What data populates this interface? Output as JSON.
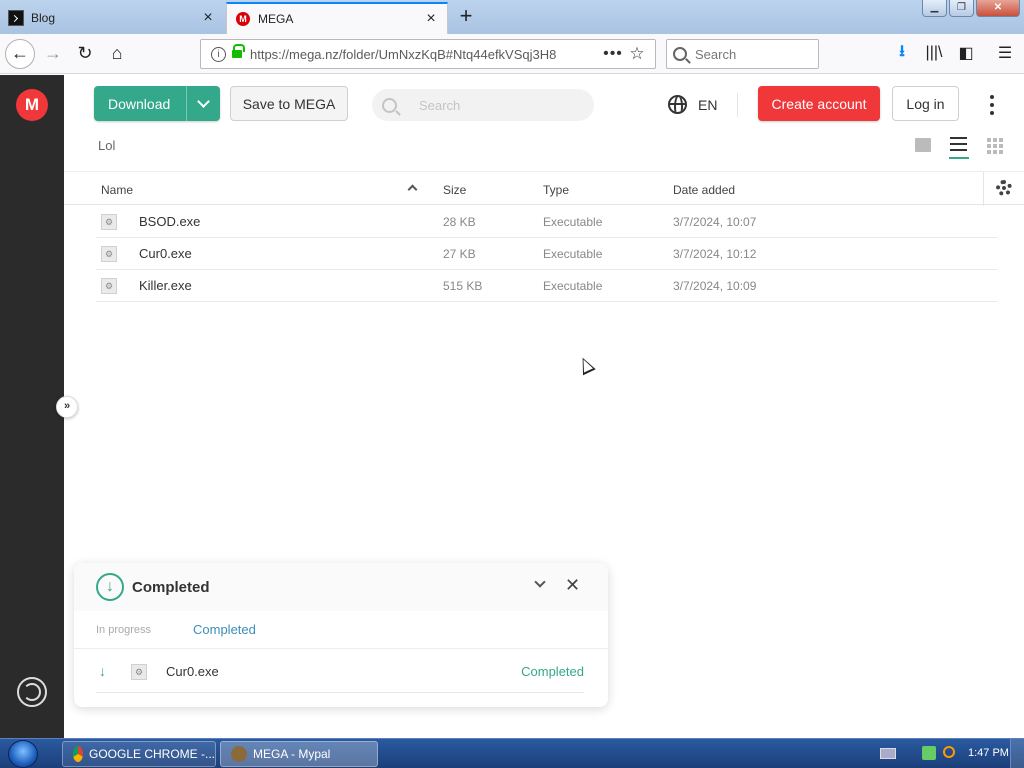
{
  "browser": {
    "tabs": [
      {
        "title": "Blog",
        "active": false
      },
      {
        "title": "MEGA",
        "active": true
      }
    ],
    "url": "https://mega.nz/folder/UmNxzKqB#Ntq44efkVSqj3H8",
    "search_placeholder": "Search"
  },
  "toolbar": {
    "download_label": "Download",
    "save_label": "Save to MEGA",
    "search_placeholder": "Search",
    "language": "EN",
    "create_account_label": "Create account",
    "login_label": "Log in"
  },
  "breadcrumb": "Lol",
  "columns": {
    "name": "Name",
    "size": "Size",
    "type": "Type",
    "date": "Date added"
  },
  "files": [
    {
      "name": "BSOD.exe",
      "size": "28 KB",
      "type": "Executable",
      "date": "3/7/2024, 10:07"
    },
    {
      "name": "Cur0.exe",
      "size": "27 KB",
      "type": "Executable",
      "date": "3/7/2024, 10:12"
    },
    {
      "name": "Killer.exe",
      "size": "515 KB",
      "type": "Executable",
      "date": "3/7/2024, 10:09"
    }
  ],
  "transfers": {
    "title": "Completed",
    "tab_in_progress": "In progress",
    "tab_completed": "Completed",
    "items": [
      {
        "name": "Cur0.exe",
        "status": "Completed"
      }
    ]
  },
  "taskbar": {
    "items": [
      {
        "label": "GOOGLE CHROME -..."
      },
      {
        "label": "MEGA - Mypal"
      }
    ],
    "clock": "1:47 PM"
  },
  "colors": {
    "mega_red": "#f0373a",
    "mega_green": "#33a88a",
    "rail": "#2b2b2b"
  }
}
